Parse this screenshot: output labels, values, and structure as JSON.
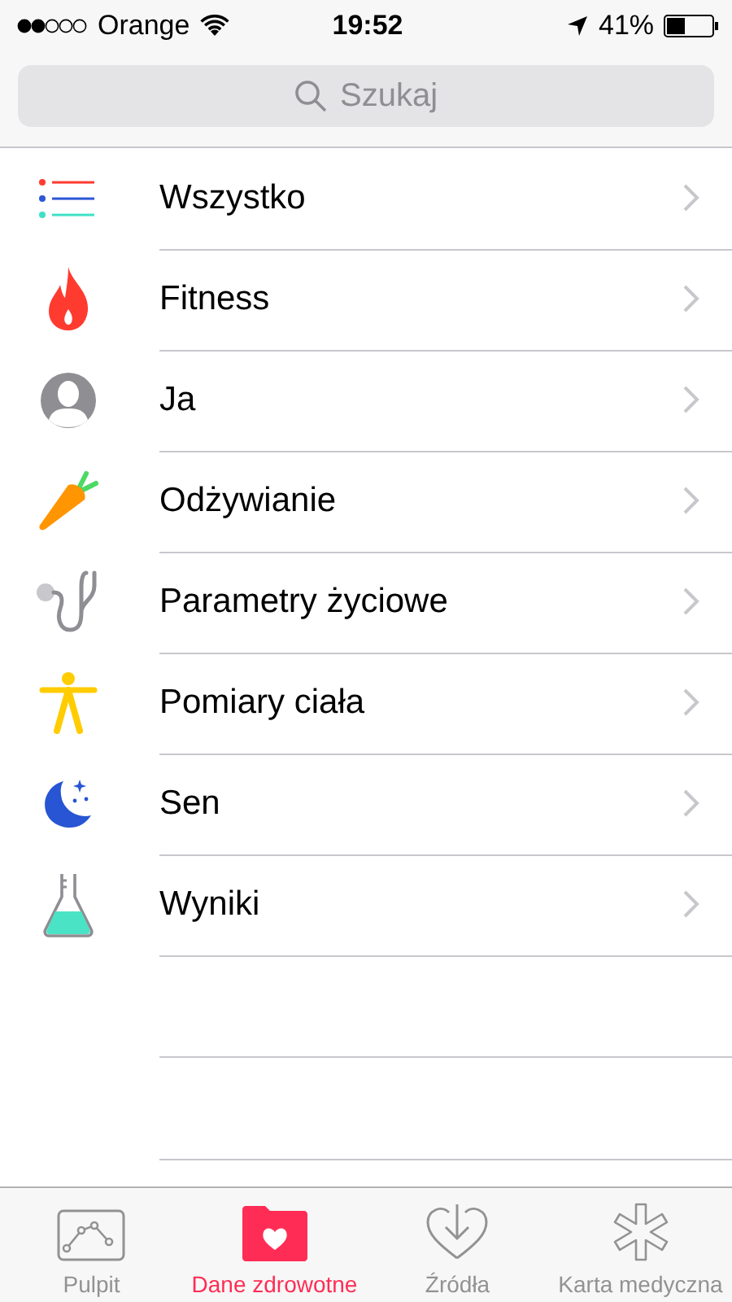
{
  "status_bar": {
    "carrier": "Orange",
    "time": "19:52",
    "battery": "41%"
  },
  "search": {
    "placeholder": "Szukaj"
  },
  "categories": [
    {
      "label": "Wszystko"
    },
    {
      "label": "Fitness"
    },
    {
      "label": "Ja"
    },
    {
      "label": "Odżywianie"
    },
    {
      "label": "Parametry życiowe"
    },
    {
      "label": "Pomiary ciała"
    },
    {
      "label": "Sen"
    },
    {
      "label": "Wyniki"
    }
  ],
  "tab_bar": [
    {
      "label": "Pulpit",
      "selected": false
    },
    {
      "label": "Dane zdrowotne",
      "selected": true
    },
    {
      "label": "Źródła",
      "selected": false
    },
    {
      "label": "Karta medyczna",
      "selected": false
    }
  ]
}
